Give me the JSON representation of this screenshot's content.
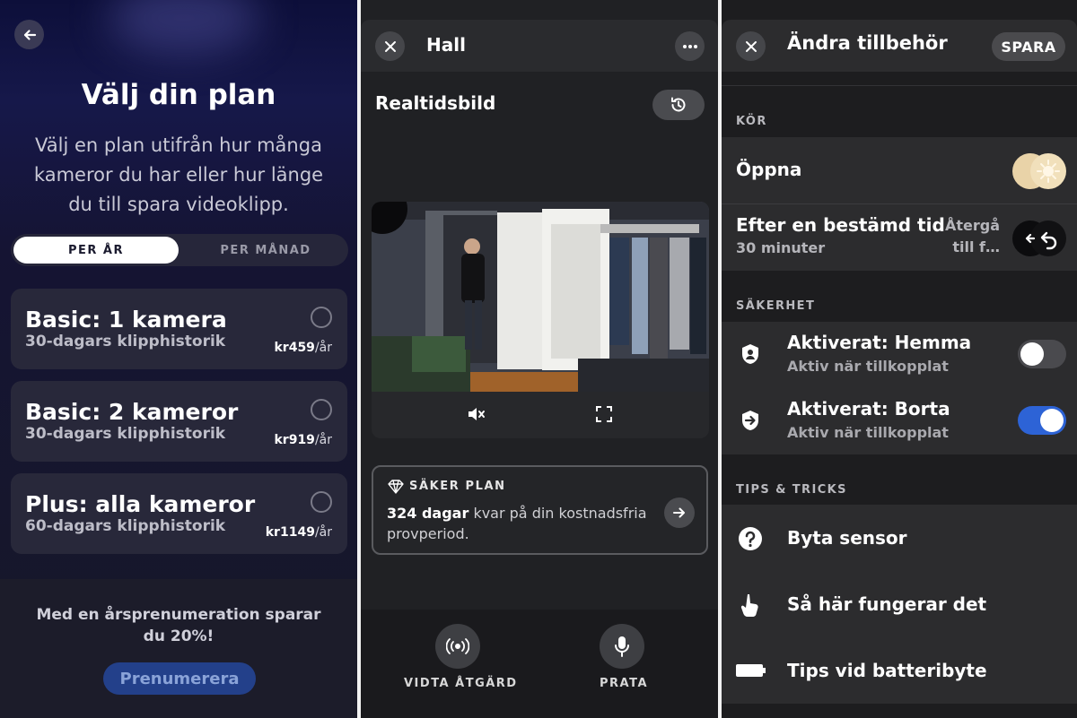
{
  "plan_screen": {
    "title": "Välj din plan",
    "subtitle": "Välj en plan utifrån hur många kameror du har eller hur länge du till spara videoklipp.",
    "billing_toggle": {
      "yearly": "PER ÅR",
      "monthly": "PER MÅNAD",
      "selected": "yearly"
    },
    "plans": [
      {
        "name": "Basic: 1 kamera",
        "desc": "30-dagars klipphistorik",
        "price": "kr459",
        "unit": "/år"
      },
      {
        "name": "Basic: 2 kameror",
        "desc": "30-dagars klipphistorik",
        "price": "kr919",
        "unit": "/år"
      },
      {
        "name": "Plus: alla kameror",
        "desc": "60-dagars klipphistorik",
        "price": "kr1149",
        "unit": "/år"
      }
    ],
    "savings_text": "Med en årsprenumeration sparar du 20%!",
    "subscribe_label": "Prenumerera"
  },
  "camera_screen": {
    "title": "Hall",
    "live_label": "Realtidsbild",
    "plan_card": {
      "label": "SÄKER PLAN",
      "days": "324 dagar",
      "rest": " kvar på din kostnadsfria provperiod."
    },
    "actions": {
      "action_label": "VIDTA ÅTGÄRD",
      "talk_label": "PRATA"
    }
  },
  "accessory_screen": {
    "title": "Ändra tillbehör",
    "save_label": "SPARA",
    "sections": {
      "run": "KÖR",
      "security": "SÄKERHET",
      "tips": "TIPS & TRICKS"
    },
    "run_rows": {
      "open": "Öppna",
      "after_time_title": "Efter en bestämd tid",
      "after_time_value": "30 minuter",
      "return_label_1": "Återgå",
      "return_label_2": "till f…"
    },
    "security_rows": [
      {
        "title": "Aktiverat: Hemma",
        "sub": "Aktiv när tillkopplat",
        "enabled": false
      },
      {
        "title": "Aktiverat: Borta",
        "sub": "Aktiv när tillkopplat",
        "enabled": true
      }
    ],
    "tips_rows": [
      {
        "label": "Byta sensor",
        "icon": "question-icon"
      },
      {
        "label": "Så här fungerar det",
        "icon": "hand-pointer-icon"
      },
      {
        "label": "Tips vid batteribyte",
        "icon": "battery-icon"
      }
    ],
    "colors": {
      "switch_on": "#2d63d6",
      "switch_off": "#4a4a4e"
    }
  }
}
